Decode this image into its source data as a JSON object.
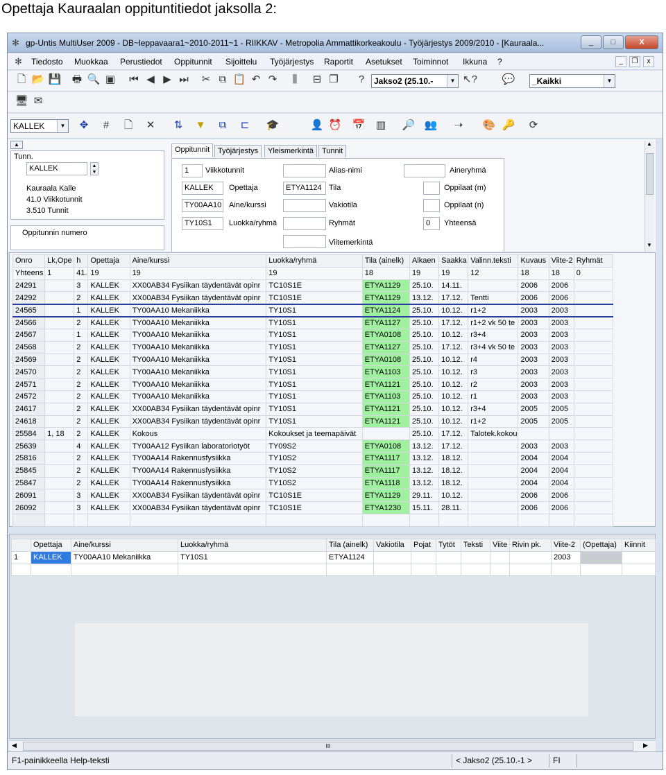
{
  "caption": "Opettaja Kauraalan oppituntitiedot jaksolla 2:",
  "window": {
    "title": "gp-Untis MultiUser 2009 - DB~leppavaara1~2010-2011~1 - RIIKKAV - Metropolia Ammattikorkeakoulu - Työjärjestys 2009/2010 - [Kauraala...",
    "min_label": "_",
    "max_label": "□",
    "close_label": "X"
  },
  "menubar": {
    "items": [
      "Tiedosto",
      "Muokkaa",
      "Perustiedot",
      "Oppitunnit",
      "Sijoittelu",
      "Työjärjestys",
      "Raportit",
      "Asetukset",
      "Toiminnot",
      "Ikkuna",
      "?"
    ],
    "mdi_min": "_",
    "mdi_restore": "❐",
    "mdi_close": "x"
  },
  "toolbar1": {
    "period_combo": "Jakso2 (25.10.-",
    "filter_combo": "_Kaikki"
  },
  "toolbar3": {
    "teacher_combo": "KALLEK"
  },
  "left_panel": {
    "tunn_label": "Tunn.",
    "tunn_value": "KALLEK",
    "name": "Kauraala Kalle",
    "viikkotunnit": "41.0 Viikkotunnit",
    "tunnit": "3.510 Tunnit",
    "oppitunnin_numero_label": "Oppitunnin numero"
  },
  "tabs": [
    "Oppitunnit",
    "Työjärjestys",
    "Yleismerkintä",
    "Tunnit"
  ],
  "lesson_form": {
    "viikkotunnit_value": "1",
    "viikkotunnit_label": "Viikkotunnit",
    "opettaja_value": "KALLEK",
    "opettaja_label": "Opettaja",
    "aine_value": "TY00AA10",
    "aine_label": "Aine/kurssi",
    "luokka_value": "TY10S1",
    "luokka_label": "Luokka/ryhmä",
    "alias_label": "Alias-nimi",
    "tila_value": "ETYA1124",
    "tila_label": "Tila",
    "vakiotila_label": "Vakiotila",
    "ryhmat_label": "Ryhmät",
    "viitemerkinta_label": "Viitemerkintä",
    "aineryhma_label": "Aineryhmä",
    "oppilaat_m_label": "Oppilaat (m)",
    "oppilaat_n_label": "Oppilaat (n)",
    "yhteensa_value": "0",
    "yhteensa_label": "Yhteensä"
  },
  "lessons_table": {
    "headers": [
      "Onro",
      "Lk,Ope",
      "h",
      "Opettaja",
      "Aine/kurssi",
      "Luokka/ryhmä",
      "Tila (ainelk)",
      "Alkaen",
      "Saakka",
      "Valinn.teksti",
      "Kuvaus",
      "Viite-2",
      "Ryhmät"
    ],
    "summary": [
      "Yhteens",
      "1",
      "41.",
      "19",
      "19",
      "19",
      "18",
      "19",
      "19",
      "12",
      "18",
      "18",
      "0"
    ],
    "rows": [
      [
        "24291",
        "",
        "3",
        "KALLEK",
        "XX00AB34 Fysiikan täydentävät opinr",
        "TC10S1E",
        "ETYA1129",
        "25.10.",
        "14.11.",
        "",
        "2006",
        "2006",
        ""
      ],
      [
        "24292",
        "",
        "2",
        "KALLEK",
        "XX00AB34 Fysiikan täydentävät opinr",
        "TC10S1E",
        "ETYA1129",
        "13.12.",
        "17.12.",
        "Tentti",
        "2006",
        "2006",
        ""
      ],
      [
        "24565",
        "",
        "1",
        "KALLEK",
        "TY00AA10 Mekaniikka",
        "TY10S1",
        "ETYA1124",
        "25.10.",
        "10.12.",
        "r1+2",
        "2003",
        "2003",
        ""
      ],
      [
        "24566",
        "",
        "2",
        "KALLEK",
        "TY00AA10 Mekaniikka",
        "TY10S1",
        "ETYA1127",
        "25.10.",
        "17.12.",
        "r1+2 vk 50 te",
        "2003",
        "2003",
        ""
      ],
      [
        "24567",
        "",
        "1",
        "KALLEK",
        "TY00AA10 Mekaniikka",
        "TY10S1",
        "ETYA0108",
        "25.10.",
        "10.12.",
        "r3+4",
        "2003",
        "2003",
        ""
      ],
      [
        "24568",
        "",
        "2",
        "KALLEK",
        "TY00AA10 Mekaniikka",
        "TY10S1",
        "ETYA1127",
        "25.10.",
        "17.12.",
        "r3+4 vk 50 te",
        "2003",
        "2003",
        ""
      ],
      [
        "24569",
        "",
        "2",
        "KALLEK",
        "TY00AA10 Mekaniikka",
        "TY10S1",
        "ETYA0108",
        "25.10.",
        "10.12.",
        "r4",
        "2003",
        "2003",
        ""
      ],
      [
        "24570",
        "",
        "2",
        "KALLEK",
        "TY00AA10 Mekaniikka",
        "TY10S1",
        "ETYA1103",
        "25.10.",
        "10.12.",
        "r3",
        "2003",
        "2003",
        ""
      ],
      [
        "24571",
        "",
        "2",
        "KALLEK",
        "TY00AA10 Mekaniikka",
        "TY10S1",
        "ETYA1121",
        "25.10.",
        "10.12.",
        "r2",
        "2003",
        "2003",
        ""
      ],
      [
        "24572",
        "",
        "2",
        "KALLEK",
        "TY00AA10 Mekaniikka",
        "TY10S1",
        "ETYA1103",
        "25.10.",
        "10.12.",
        "r1",
        "2003",
        "2003",
        ""
      ],
      [
        "24617",
        "",
        "2",
        "KALLEK",
        "XX00AB34 Fysiikan täydentävät opinr",
        "TY10S1",
        "ETYA1121",
        "25.10.",
        "10.12.",
        "r3+4",
        "2005",
        "2005",
        ""
      ],
      [
        "24618",
        "",
        "2",
        "KALLEK",
        "XX00AB34 Fysiikan täydentävät opinr",
        "TY10S1",
        "ETYA1121",
        "25.10.",
        "10.12.",
        "r1+2",
        "2005",
        "2005",
        ""
      ],
      [
        "25584",
        "1, 18",
        "2",
        "KALLEK",
        "Kokous",
        "Kokoukset ja teemapäivät",
        "",
        "25.10.",
        "17.12.",
        "Talotek.kokou",
        "",
        "",
        ""
      ],
      [
        "25639",
        "",
        "4",
        "KALLEK",
        "TY00AA12 Fysiikan laboratoriotyöt",
        "TY09S2",
        "ETYA0108",
        "13.12.",
        "17.12.",
        "",
        "2003",
        "2003",
        ""
      ],
      [
        "25816",
        "",
        "2",
        "KALLEK",
        "TY00AA14 Rakennusfysiikka",
        "TY10S2",
        "ETYA1117",
        "13.12.",
        "18.12.",
        "",
        "2004",
        "2004",
        ""
      ],
      [
        "25845",
        "",
        "2",
        "KALLEK",
        "TY00AA14 Rakennusfysiikka",
        "TY10S2",
        "ETYA1117",
        "13.12.",
        "18.12.",
        "",
        "2004",
        "2004",
        ""
      ],
      [
        "25847",
        "",
        "2",
        "KALLEK",
        "TY00AA14 Rakennusfysiikka",
        "TY10S2",
        "ETYA1118",
        "13.12.",
        "18.12.",
        "",
        "2004",
        "2004",
        ""
      ],
      [
        "26091",
        "",
        "3",
        "KALLEK",
        "XX00AB34 Fysiikan täydentävät opinr",
        "TC10S1E",
        "ETYA1129",
        "29.11.",
        "10.12.",
        "",
        "2006",
        "2006",
        ""
      ],
      [
        "26092",
        "",
        "3",
        "KALLEK",
        "XX00AB34 Fysiikan täydentävät opinr",
        "TC10S1E",
        "ETYA1230",
        "15.11.",
        "28.11.",
        "",
        "2006",
        "2006",
        ""
      ]
    ],
    "selected_onro": "24565"
  },
  "detail_table": {
    "headers": [
      "",
      "Opettaja",
      "Aine/kurssi",
      "Luokka/ryhmä",
      "Tila (ainelk)",
      "Vakiotila",
      "Pojat",
      "Tytöt",
      "Teksti",
      "Viite",
      "Rivin pk.",
      "Viite-2",
      "(Opettaja)",
      "Kiinnit"
    ],
    "row": [
      "1",
      "KALLEK",
      "TY00AA10 Mekaniikka",
      "TY10S1",
      "ETYA1124",
      "",
      "",
      "",
      "",
      "",
      "",
      "2003",
      "",
      ""
    ]
  },
  "hscroll_thumb": "III",
  "statusbar": {
    "help": "F1-painikkeella Help-teksti",
    "period": "< Jakso2 (25.10.-1 >",
    "lang": "FI"
  }
}
